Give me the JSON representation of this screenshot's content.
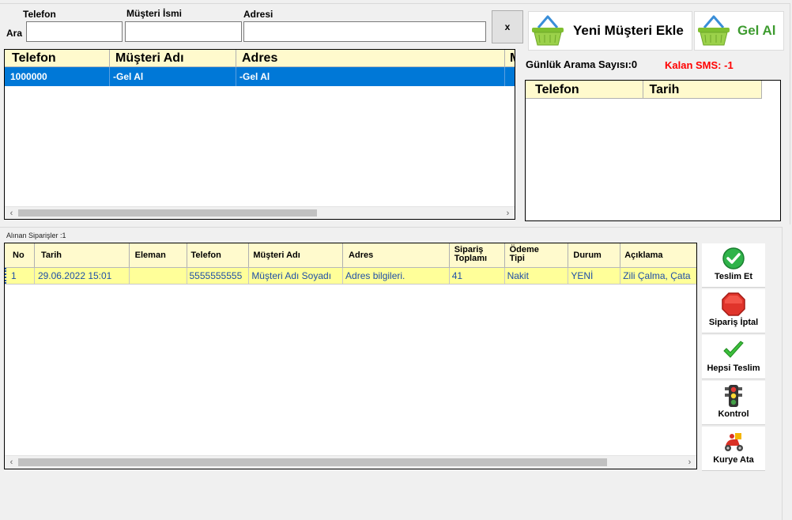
{
  "search": {
    "label": "Ara",
    "phone_label": "Telefon",
    "name_label": "Müşteri İsmi",
    "address_label": "Adresi",
    "phone_value": "",
    "name_value": "",
    "address_value": "",
    "clear_label": "x"
  },
  "actions": {
    "new_customer_label": "Yeni Müşteri Ekle",
    "pickup_label": "Gel Al"
  },
  "customers": {
    "columns": [
      "Telefon",
      "Müşteri Adı",
      "Adres",
      "M"
    ],
    "rows": [
      [
        "1000000",
        "-Gel Al",
        "-Gel Al",
        ""
      ]
    ]
  },
  "daily": {
    "count_text": "Günlük Arama Sayısı:0",
    "sms_text": "Kalan SMS: -1"
  },
  "calls": {
    "columns": [
      "Telefon",
      "Tarih"
    ]
  },
  "orders": {
    "caption": "Alınan Siparişler :1",
    "columns": [
      "No",
      "Tarih",
      "Eleman",
      "Telefon",
      "Müşteri Adı",
      "Adres",
      "Sipariş\nToplamı",
      "Ödeme\nTipi",
      "Durum",
      "Açıklama"
    ],
    "rows": [
      [
        "1",
        "29.06.2022 15:01",
        "",
        "5555555555",
        "Müşteri Adı Soyadı",
        "Adres bilgileri.",
        "41",
        "Nakit",
        "YENİ",
        "Zili Çalma, Çata"
      ]
    ]
  },
  "side_buttons": [
    {
      "label": "Teslim Et",
      "icon": "check-circle-icon"
    },
    {
      "label": "Sipariş İptal",
      "icon": "stop-sign-icon"
    },
    {
      "label": "Hepsi Teslim",
      "icon": "checkmark-icon"
    },
    {
      "label": "Kontrol",
      "icon": "traffic-light-icon"
    },
    {
      "label": "Kurye Ata",
      "icon": "courier-scooter-icon"
    }
  ],
  "colors": {
    "grid_header": "#fffacd",
    "selected_row": "#0078d7",
    "order_row": "#ffff99",
    "order_text": "#1f4fa8",
    "sms_red": "#ff0000",
    "basket_green": "#8cc63f"
  }
}
